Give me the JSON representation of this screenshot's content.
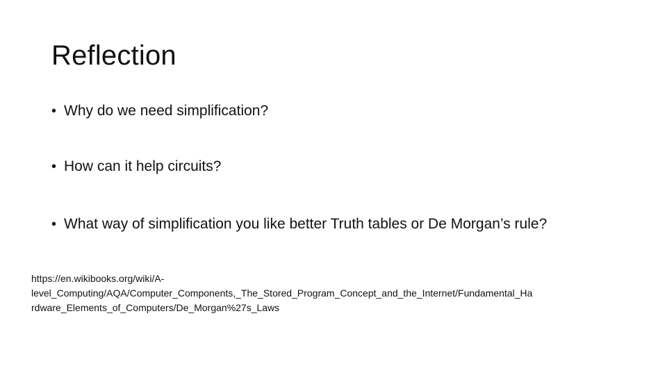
{
  "slide": {
    "title": "Reflection",
    "bullets": [
      {
        "marker": "•",
        "text": "Why do we need simplification?"
      },
      {
        "marker": "•",
        "text": "How can it help circuits?"
      },
      {
        "marker": "•",
        "text": "What way of simplification you like better Truth tables or De Morgan’s rule?"
      }
    ],
    "source": {
      "line1": "https://en.wikibooks.org/wiki/A-",
      "line2": "level_Computing/AQA/Computer_Components,_The_Stored_Program_Concept_and_the_Internet/Fundamental_Ha",
      "line3": "rdware_Elements_of_Computers/De_Morgan%27s_Laws"
    }
  }
}
